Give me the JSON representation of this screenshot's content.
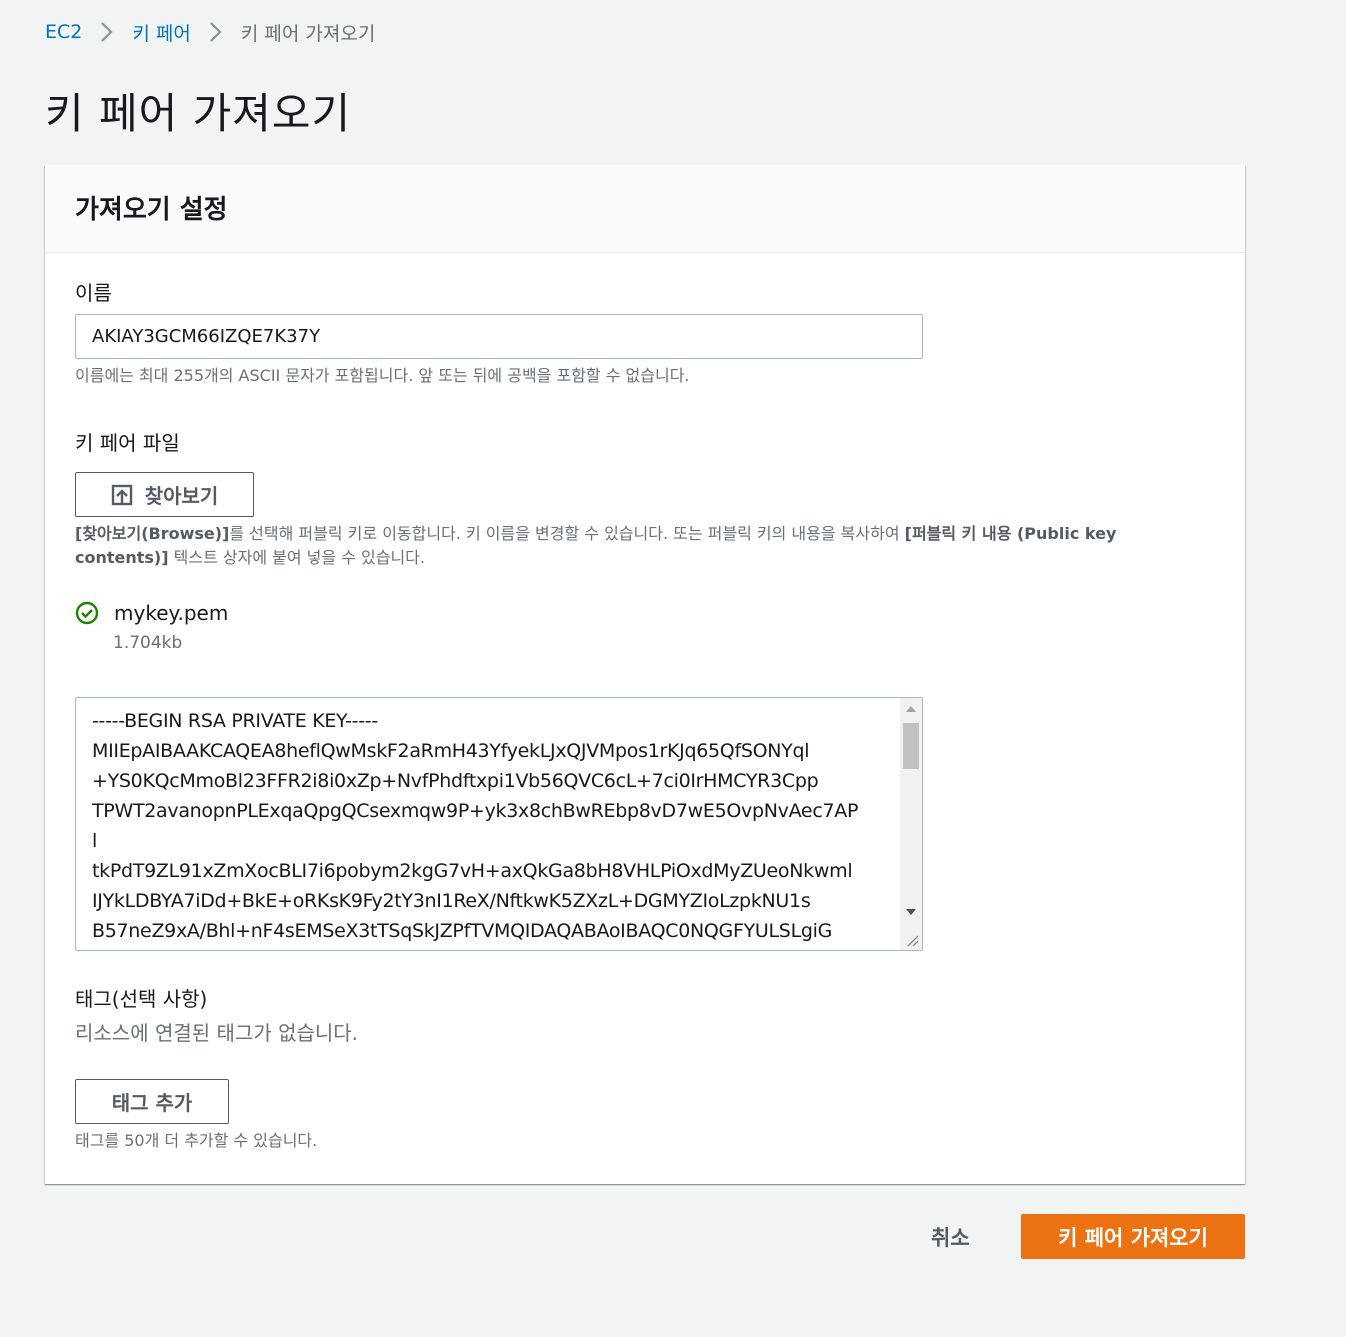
{
  "breadcrumb": {
    "items": [
      {
        "label": "EC2"
      },
      {
        "label": "키 페어"
      },
      {
        "label": "키 페어 가져오기"
      }
    ]
  },
  "page": {
    "title": "키 페어 가져오기"
  },
  "panel": {
    "title": "가져오기 설정",
    "name_field": {
      "label": "이름",
      "value": "AKIAY3GCM66IZQE7K37Y",
      "hint": "이름에는 최대 255개의 ASCII 문자가 포함됩니다. 앞 또는 뒤에 공백을 포함할 수 없습니다."
    },
    "key_file": {
      "label": "키 페어 파일",
      "browse_label": "찾아보기",
      "hint_bold_1": "[찾아보기(Browse)]",
      "hint_text_1": "를 선택해 퍼블릭 키로 이동합니다. 키 이름을 변경할 수 있습니다. 또는 퍼블릭 키의 내용을 복사하여 ",
      "hint_bold_2": "[퍼블릭 키 내용 (Public key contents)]",
      "hint_text_2": " 텍스트 상자에 붙여 넣을 수 있습니다.",
      "file_name": "mykey.pem",
      "file_size": "1.704kb",
      "status_color": "#1d8102",
      "contents": "-----BEGIN RSA PRIVATE KEY-----\nMIIEpAIBAAKCAQEA8heflQwMskF2aRmH43YfyekLJxQJVMpos1rKJq65QfSONYql\n+YS0KQcMmoBl23FFR2i8i0xZp+NvfPhdftxpi1Vb56QVC6cL+7ci0IrHMCYR3Cpp\nTPWT2avanopnPLExqaQpgQCsexmqw9P+yk3x8chBwREbp8vD7wE5OvpNvAec7AP\nl\ntkPdT9ZL91xZmXocBLI7i6pobym2kgG7vH+axQkGa8bH8VHLPiOxdMyZUeoNkwml\nIJYkLDBYA7iDd+BkE+oRKsK9Fy2tY3nI1ReX/NftkwK5ZXzL+DGMYZIoLzpkNU1s\nB57neZ9xA/Bhl+nF4sEMSeX3tTSqSkJZPfTVMQIDAQABAoIBAQC0NQGFYULSLgiG"
    },
    "tags": {
      "label": "태그(선택 사항)",
      "empty_text": "리소스에 연결된 태그가 없습니다.",
      "add_label": "태그 추가",
      "hint": "태그를 50개 더 추가할 수 있습니다."
    }
  },
  "footer": {
    "cancel_label": "취소",
    "submit_label": "키 페어 가져오기",
    "submit_color": "#ec7211"
  },
  "icons": {
    "breadcrumb_separator": "chevron-right-icon",
    "browse": "upload-icon",
    "file_status": "check-circle-icon"
  }
}
